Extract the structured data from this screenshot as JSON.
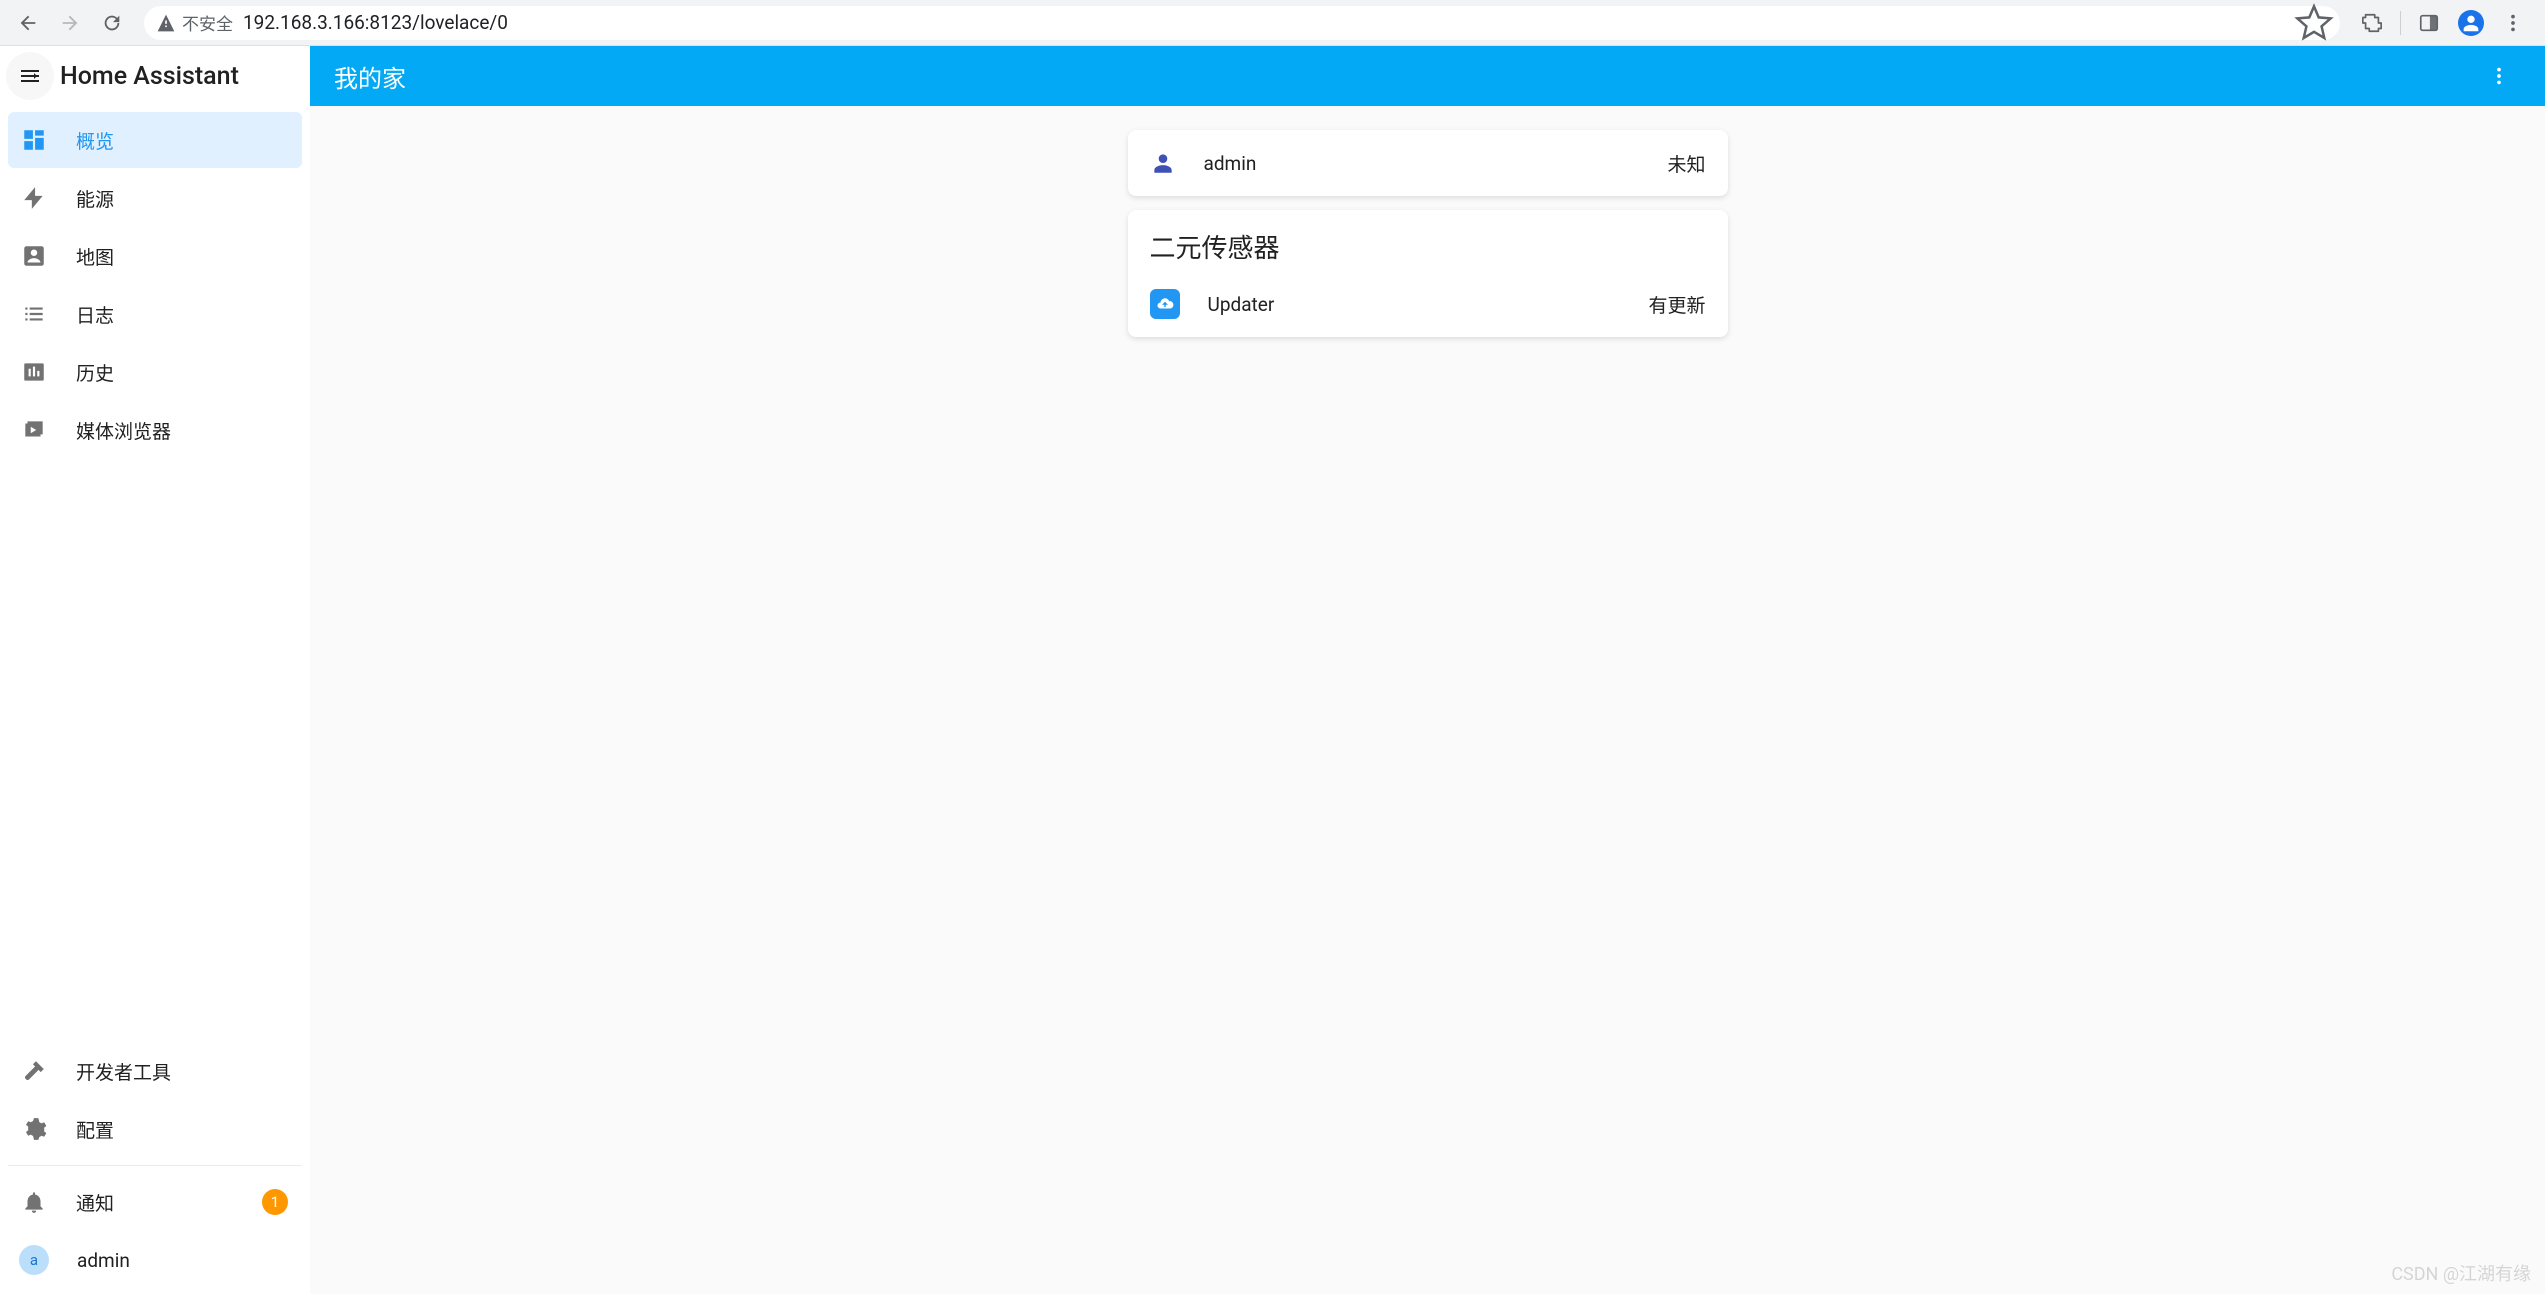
{
  "browser": {
    "security_label": "不安全",
    "url": "192.168.3.166:8123/lovelace/0"
  },
  "sidebar": {
    "title": "Home Assistant",
    "items": [
      {
        "label": "概览"
      },
      {
        "label": "能源"
      },
      {
        "label": "地图"
      },
      {
        "label": "日志"
      },
      {
        "label": "历史"
      },
      {
        "label": "媒体浏览器"
      }
    ],
    "footer": {
      "dev_tools": "开发者工具",
      "config": "配置",
      "notifications": "通知",
      "notifications_count": "1",
      "user": "admin",
      "user_initial": "a"
    }
  },
  "header": {
    "title": "我的家"
  },
  "cards": {
    "person": {
      "name": "admin",
      "state": "未知"
    },
    "binary_sensor": {
      "title": "二元传感器",
      "entity_name": "Updater",
      "entity_state": "有更新"
    }
  },
  "watermark": "CSDN @江湖有缘"
}
